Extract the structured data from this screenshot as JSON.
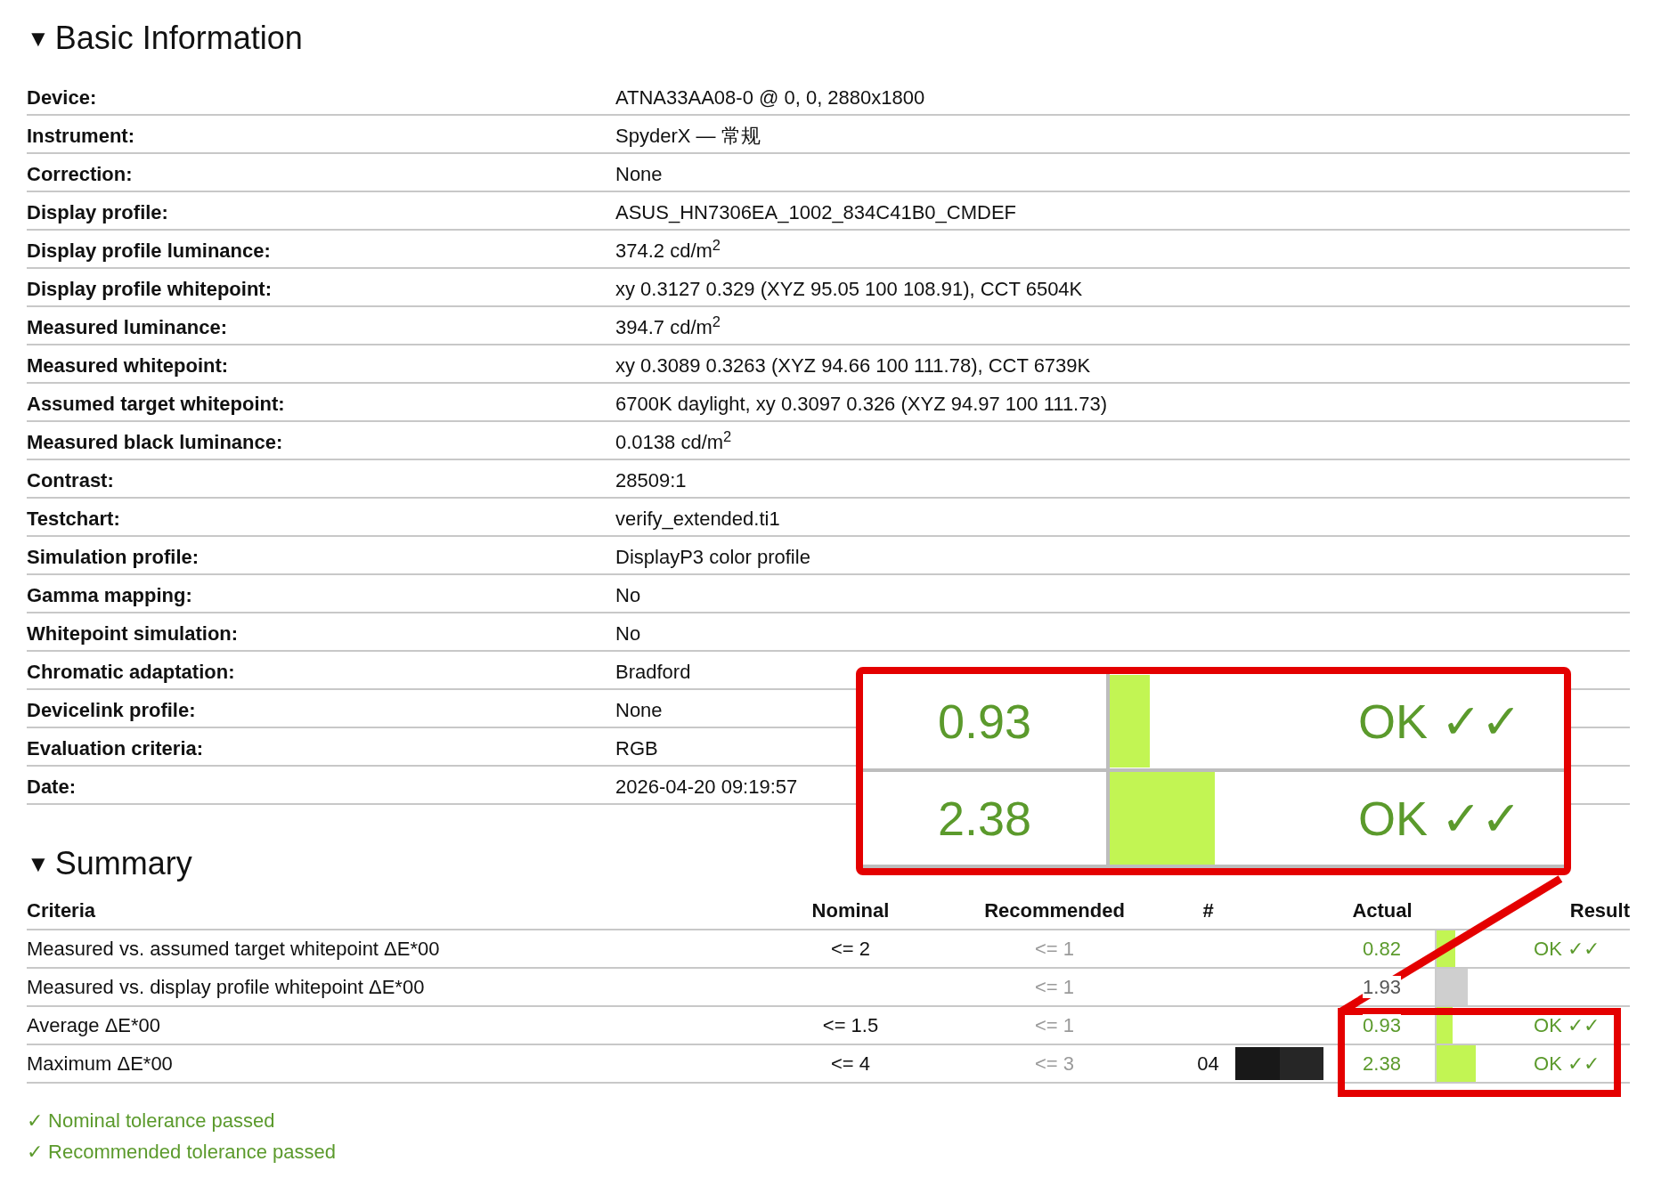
{
  "basic": {
    "toggle": "▼",
    "title": "Basic Information",
    "rows": [
      {
        "label": "Device:",
        "value": "ATNA33AA08-0 @ 0, 0, 2880x1800"
      },
      {
        "label": "Instrument:",
        "value": "SpyderX — 常规"
      },
      {
        "label": "Correction:",
        "value": "None"
      },
      {
        "label": "Display profile:",
        "value": "ASUS_HN7306EA_1002_834C41B0_CMDEF"
      },
      {
        "label": "Display profile luminance:",
        "value": "374.2 cd/m$^{2}$"
      },
      {
        "label": "Display profile whitepoint:",
        "value": "xy 0.3127 0.329 (XYZ 95.05 100 108.91), CCT 6504K"
      },
      {
        "label": "Measured luminance:",
        "value": "394.7 cd/m$^{2}$"
      },
      {
        "label": "Measured whitepoint:",
        "value": "xy 0.3089 0.3263 (XYZ 94.66 100 111.78), CCT 6739K"
      },
      {
        "label": "Assumed target whitepoint:",
        "value": "6700K daylight, xy 0.3097 0.326 (XYZ 94.97 100 111.73)"
      },
      {
        "label": "Measured black luminance:",
        "value": "0.0138 cd/m$^{2}$"
      },
      {
        "label": "Contrast:",
        "value": "28509:1"
      },
      {
        "label": "Testchart:",
        "value": "verify_extended.ti1"
      },
      {
        "label": "Simulation profile:",
        "value": "DisplayP3 color profile"
      },
      {
        "label": "Gamma mapping:",
        "value": "No"
      },
      {
        "label": "Whitepoint simulation:",
        "value": "No"
      },
      {
        "label": "Chromatic adaptation:",
        "value": "Bradford"
      },
      {
        "label": "Devicelink profile:",
        "value": "None"
      },
      {
        "label": "Evaluation criteria:",
        "value": "RGB"
      },
      {
        "label": "Date:",
        "value": "2026-04-20 09:19:57"
      }
    ]
  },
  "summary": {
    "toggle": "▼",
    "title": "Summary",
    "columns": [
      "Criteria",
      "Nominal",
      "Recommended",
      "#",
      "Actual",
      "Result"
    ],
    "rows": [
      {
        "criteria": "Measured vs. assumed target whitepoint ΔE*00",
        "nominal": "<= 2",
        "recommended": "<= 1",
        "actual": "0.82",
        "level": 0.27,
        "result": "OK ✓✓",
        "swatch": false
      },
      {
        "criteria": "Measured vs. display profile whitepoint ΔE*00",
        "recommended": "<= 1",
        "actual": "1.93",
        "level": 0.45,
        "swatch": false
      },
      {
        "criteria": "Average ΔE*00",
        "nominal": "<= 1.5",
        "recommended": "<= 1",
        "actual": "0.93",
        "level": 0.23,
        "result": "OK ✓✓",
        "swatch": false
      },
      {
        "criteria": "Maximum ΔE*00",
        "nominal": "<= 4",
        "recommended": "<= 3",
        "number": "04",
        "actual": "2.38",
        "level": 0.57,
        "result": "OK ✓✓",
        "swatch": true
      }
    ],
    "notes": [
      "✓ Nominal tolerance passed",
      "✓ Recommended tolerance passed"
    ]
  },
  "callout": {
    "rows": [
      {
        "actual": "0.93",
        "level": 0.24,
        "result": "OK ✓✓"
      },
      {
        "actual": "2.38",
        "level": 0.63,
        "result": "OK ✓✓"
      }
    ]
  }
}
